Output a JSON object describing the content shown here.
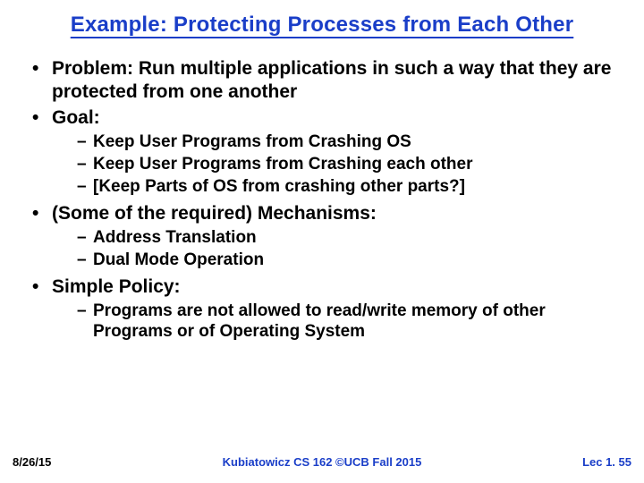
{
  "title": "Example: Protecting Processes from Each Other",
  "bullets": {
    "b0": "Problem: Run multiple applications in such a way that they are protected from one another",
    "b1": "Goal:",
    "b1_subs": {
      "s0": "Keep User Programs from Crashing OS",
      "s1": "Keep User Programs from Crashing each other",
      "s2": "[Keep Parts of OS from crashing other parts?]"
    },
    "b2": "(Some of the required) Mechanisms:",
    "b2_subs": {
      "s0": "Address Translation",
      "s1": "Dual Mode Operation"
    },
    "b3": "Simple Policy:",
    "b3_subs": {
      "s0": "Programs are not allowed to read/write memory of other Programs or of Operating System"
    }
  },
  "footer": {
    "date": "8/26/15",
    "center": "Kubiatowicz CS 162 ©UCB Fall 2015",
    "lec": "Lec 1. 55"
  }
}
